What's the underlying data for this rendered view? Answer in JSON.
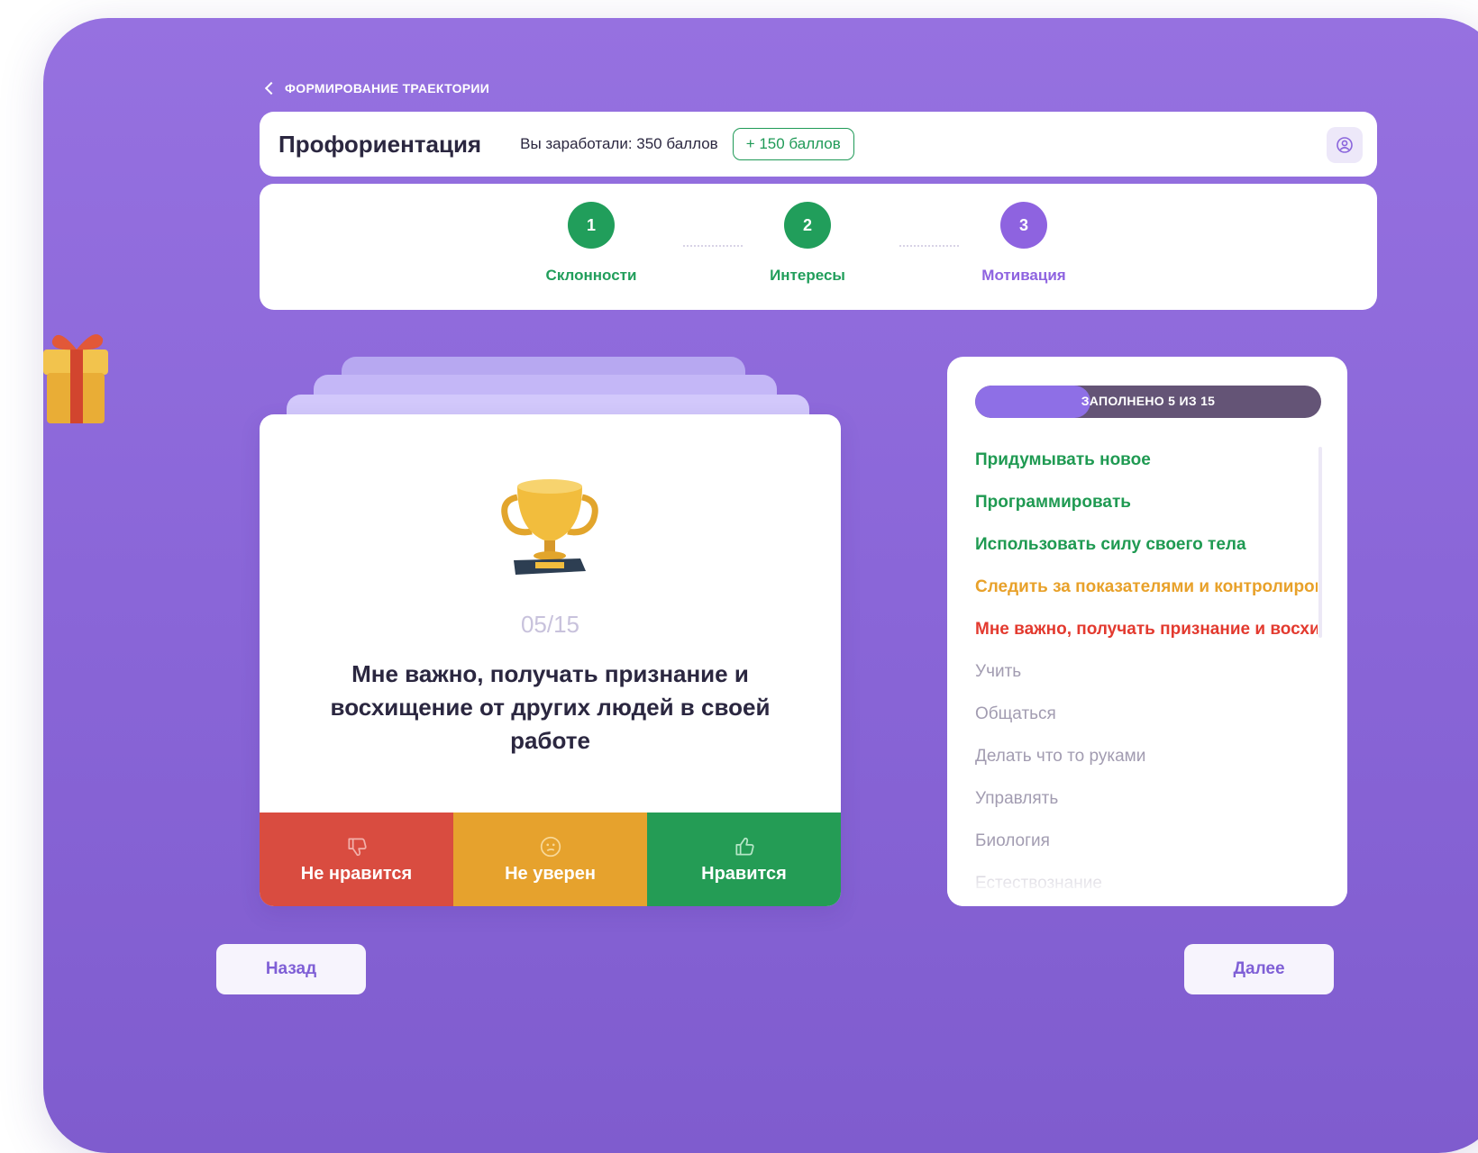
{
  "breadcrumb": "ФОРМИРОВАНИЕ ТРАЕКТОРИИ",
  "header": {
    "title": "Профориентация",
    "earned": "Вы заработали: 350 баллов",
    "bonus": "+ 150 баллов",
    "profile_icon": "profile-icon"
  },
  "steps": [
    {
      "number": "1",
      "label": "Склонности",
      "color": "#219e5b"
    },
    {
      "number": "2",
      "label": "Интересы",
      "color": "#219e5b"
    },
    {
      "number": "3",
      "label": "Мотивация",
      "color": "#8e63e0"
    }
  ],
  "card": {
    "counter": "05/15",
    "question": "Мне важно, получать признание и восхищение от других людей в своей работе",
    "image_icon": "trophy-icon",
    "actions": [
      {
        "label": "Не нравится",
        "color": "#d94c40",
        "icon": "thumbs-down-icon"
      },
      {
        "label": "Не уверен",
        "color": "#e6a22d",
        "icon": "confused-face-icon"
      },
      {
        "label": "Нравится",
        "color": "#249c55",
        "icon": "thumbs-up-icon"
      }
    ]
  },
  "list": {
    "progress_label": "ЗАПОЛНЕНО 5 ИЗ 15",
    "progress_fraction": 0.333,
    "items": [
      {
        "label": "Придумывать новое",
        "color": "#1f9a52"
      },
      {
        "label": "Программировать",
        "color": "#1f9a52"
      },
      {
        "label": "Использовать силу своего тела",
        "color": "#1f9a52"
      },
      {
        "label": "Следить за показателями и контролировать",
        "color": "#e8a12a"
      },
      {
        "label": "Мне важно, получать признание и восхищение",
        "color": "#e33a2f"
      },
      {
        "label": "Учить",
        "color": "#a29cb1"
      },
      {
        "label": "Общаться",
        "color": "#a29cb1"
      },
      {
        "label": "Делать что то руками",
        "color": "#a29cb1"
      },
      {
        "label": "Управлять",
        "color": "#a29cb1"
      },
      {
        "label": "Биология",
        "color": "#a29cb1"
      },
      {
        "label": "Естествознание",
        "color": "#a29cb1"
      }
    ]
  },
  "nav": {
    "back": "Назад",
    "next": "Далее"
  },
  "decor": {
    "gift_icon": "gift-icon"
  }
}
